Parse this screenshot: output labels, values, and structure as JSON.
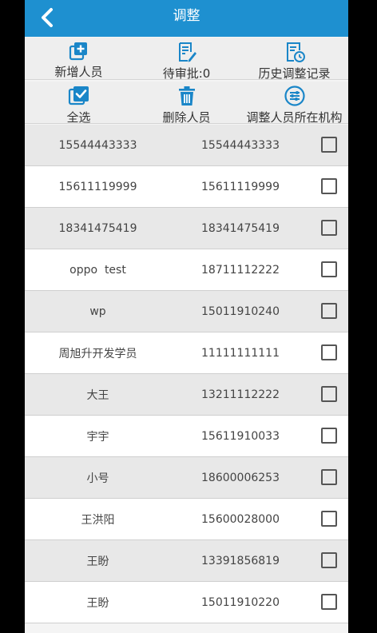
{
  "header": {
    "title": "调整"
  },
  "toolbar1": [
    {
      "label": "新增人员",
      "icon": "add-person-icon"
    },
    {
      "label": "待审批:0",
      "icon": "approval-document-icon"
    },
    {
      "label": "历史调整记录",
      "icon": "history-record-icon"
    }
  ],
  "toolbar2": [
    {
      "label": "全选",
      "icon": "select-all-icon"
    },
    {
      "label": "删除人员",
      "icon": "trash-icon"
    },
    {
      "label": "调整人员所在机构",
      "icon": "adjust-org-icon"
    }
  ],
  "rows": [
    {
      "name": "15544443333",
      "phone": "15544443333",
      "checked": false
    },
    {
      "name": "15611119999",
      "phone": "15611119999",
      "checked": false
    },
    {
      "name": "18341475419",
      "phone": "18341475419",
      "checked": false
    },
    {
      "name": "oppo  test",
      "phone": "18711112222",
      "checked": false
    },
    {
      "name": "wp",
      "phone": "15011910240",
      "checked": false
    },
    {
      "name": "周旭升开发学员",
      "phone": "11111111111",
      "checked": false
    },
    {
      "name": "大王",
      "phone": "13211112222",
      "checked": false
    },
    {
      "name": "宇宇",
      "phone": "15611910033",
      "checked": false
    },
    {
      "name": "小号",
      "phone": "18600006253",
      "checked": false
    },
    {
      "name": "王洪阳",
      "phone": "15600028000",
      "checked": false
    },
    {
      "name": "王盼",
      "phone": "13391856819",
      "checked": false
    },
    {
      "name": "王盼",
      "phone": "15011910220",
      "checked": false
    }
  ],
  "colors": {
    "header_bg": "#1e90d0",
    "icon_blue": "#1a86c8",
    "row_alt": "#e8e8e8"
  }
}
